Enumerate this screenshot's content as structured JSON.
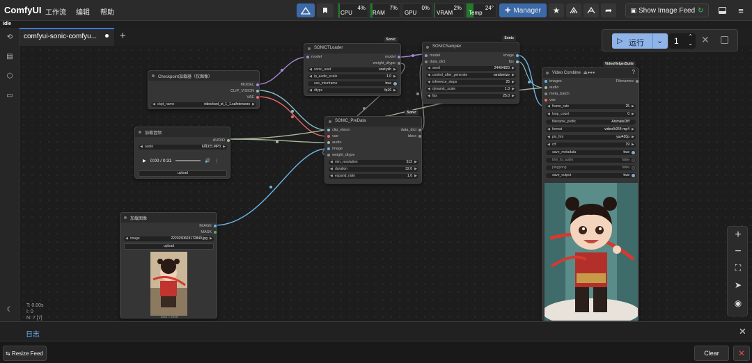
{
  "app": {
    "name": "ComfyUI",
    "status": "Idle"
  },
  "menu": [
    "工作流",
    "编辑",
    "帮助"
  ],
  "monitors": [
    {
      "label": "CPU",
      "value": "4%",
      "level": 0.04
    },
    {
      "label": "RAM",
      "value": "7%",
      "level": 0.07
    },
    {
      "label": "GPU",
      "value": "0%",
      "level": 0.0
    },
    {
      "label": "VRAM",
      "value": "2%",
      "level": 0.02
    },
    {
      "label": "Temp",
      "value": "24°",
      "level": 0.24
    }
  ],
  "toolbar": {
    "manager": "Manager",
    "feed": "Show Image Feed"
  },
  "tab": {
    "label": "comfyui-sonic-comfyu..."
  },
  "run": {
    "label": "运行",
    "count": "1"
  },
  "nodes": {
    "checkpoint": {
      "title": "Checkpoint加载器（仅图像）",
      "outputs": [
        "MODEL",
        "CLIP_VISION",
        "VAE"
      ],
      "widget": {
        "label": "ckpt_name",
        "value": "video/svd_xt_1_1.safetensors"
      }
    },
    "audio": {
      "title": "加载音频",
      "output": "AUDIO",
      "widget": {
        "label": "audio",
        "value": "6月3日.MP3"
      },
      "player": "0:00 / 0:31",
      "upload": "upload"
    },
    "image": {
      "title": "加载图像",
      "outputs": [
        "IMAGE",
        "MASK"
      ],
      "widget": {
        "label": "image",
        "value": "2220250603172840.jpg"
      },
      "upload": "upload",
      "size": "1152 × 2048"
    },
    "loader": {
      "title": "SONICTLoader",
      "badge": "Sonic",
      "input": "model",
      "outputs": [
        "model",
        "weight_dtype"
      ],
      "widgets": [
        {
          "label": "sonic_unet",
          "value": "unet.pth"
        },
        {
          "label": "ip_audio_scale",
          "value": "1.0"
        },
        {
          "label": "use_interframe",
          "value": "true"
        },
        {
          "label": "dtype",
          "value": "fp16"
        }
      ]
    },
    "sampler": {
      "title": "SONICSampler",
      "badge": "Sonic",
      "inputs": [
        "model",
        "data_dict"
      ],
      "outputs": [
        "image",
        "fps"
      ],
      "widgets": [
        {
          "label": "seed",
          "value": "24404823"
        },
        {
          "label": "control_after_generate",
          "value": "randomize"
        },
        {
          "label": "inference_steps",
          "value": "25"
        },
        {
          "label": "dynamic_scale",
          "value": "1.3"
        },
        {
          "label": "fps",
          "value": "25.0"
        }
      ]
    },
    "predata": {
      "title": "SONIC_PreData",
      "badge": "Sonic",
      "inputs": [
        "clip_vision",
        "vae",
        "audio",
        "image",
        "weight_dtype"
      ],
      "outputs": [
        "data_dict",
        "bbox"
      ],
      "widgets": [
        {
          "label": "min_resolution",
          "value": "512"
        },
        {
          "label": "duration",
          "value": "32.0"
        },
        {
          "label": "expand_ratio",
          "value": "1.0"
        }
      ]
    },
    "combine": {
      "title": "Video Combine",
      "badge": "VideoHelperSuite",
      "inputs": [
        "images",
        "audio",
        "meta_batch",
        "vae"
      ],
      "output": "Filenames",
      "widgets": [
        {
          "label": "frame_rate",
          "value": "25"
        },
        {
          "label": "loop_count",
          "value": "0"
        },
        {
          "label": "filename_prefix",
          "value": "AnimateDiff"
        },
        {
          "label": "format",
          "value": "video/h264-mp4"
        },
        {
          "label": "pix_fmt",
          "value": "yuv420p"
        },
        {
          "label": "crf",
          "value": "19"
        },
        {
          "label": "save_metadata",
          "value": "true"
        },
        {
          "label": "trim_to_audio",
          "value": "false"
        },
        {
          "label": "pingpong",
          "value": "false"
        },
        {
          "label": "save_output",
          "value": "true"
        }
      ]
    }
  },
  "stats": {
    "t": "T: 0.00s",
    "i": "I: 0",
    "n": "N: 7 [7]"
  },
  "log": {
    "label": "日志"
  },
  "bottom": {
    "resize": "Resize Feed",
    "clear": "Clear"
  },
  "colors": {
    "accent": "#3a7bd5",
    "monitor": "#1f7a2a",
    "run": "#8fb4e8"
  }
}
